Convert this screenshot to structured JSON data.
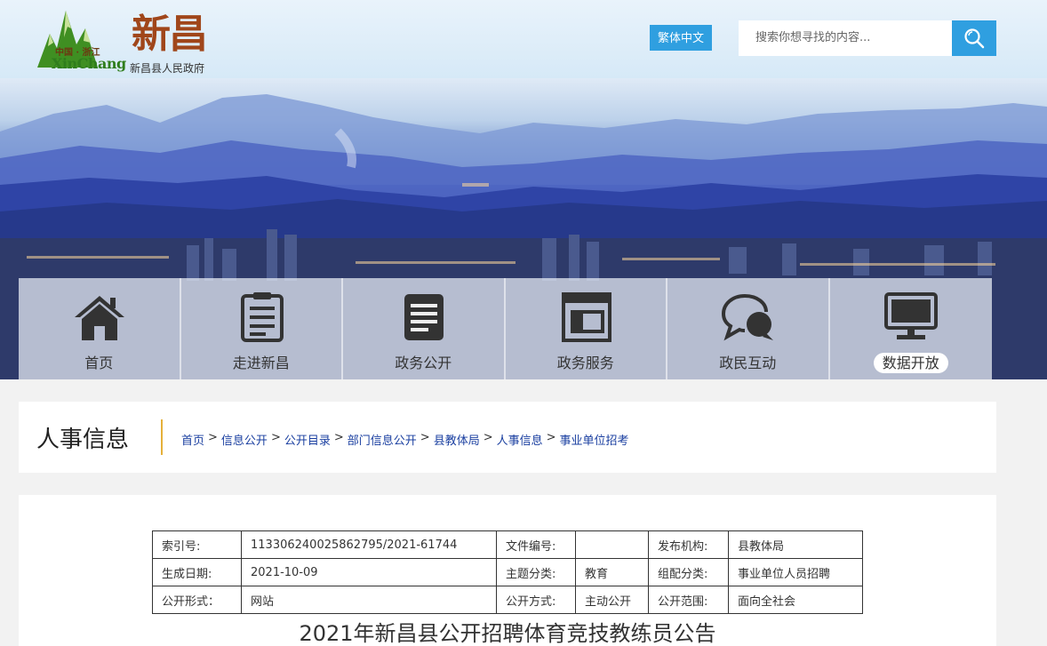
{
  "header": {
    "logo_small": "中国 · 浙江",
    "logo_latin": "XinChang",
    "logo_big": "新昌",
    "gov_name": "新昌县人民政府",
    "lang_button": "繁体中文",
    "search_placeholder": "搜索你想寻找的内容...",
    "search_icon": "search-icon",
    "accent_color": "#2f9fe0"
  },
  "nav": {
    "items": [
      {
        "label": "首页",
        "icon": "home-icon"
      },
      {
        "label": "走进新昌",
        "icon": "document-list-icon"
      },
      {
        "label": "政务公开",
        "icon": "notes-icon"
      },
      {
        "label": "政务服务",
        "icon": "window-icon"
      },
      {
        "label": "政民互动",
        "icon": "chat-bubbles-icon"
      },
      {
        "label": "数据开放",
        "icon": "monitor-icon"
      }
    ]
  },
  "breadcrumb": {
    "title": "人事信息",
    "items": [
      "首页",
      "信息公开",
      "公开目录",
      "部门信息公开",
      "县教体局",
      "人事信息",
      "事业单位招考"
    ]
  },
  "meta": {
    "rows": [
      [
        "索引号:",
        "113306240025862795/2021-61744",
        "文件编号:",
        "",
        "发布机构:",
        "县教体局"
      ],
      [
        "生成日期:",
        "2021-10-09",
        "主题分类:",
        "教育",
        "组配分类:",
        "事业单位人员招聘"
      ],
      [
        "公开形式：",
        "网站",
        "公开方式:",
        "主动公开",
        "公开范围:",
        "面向全社会"
      ]
    ]
  },
  "document": {
    "title": "2021年新昌县公开招聘体育竞技教练员公告"
  }
}
